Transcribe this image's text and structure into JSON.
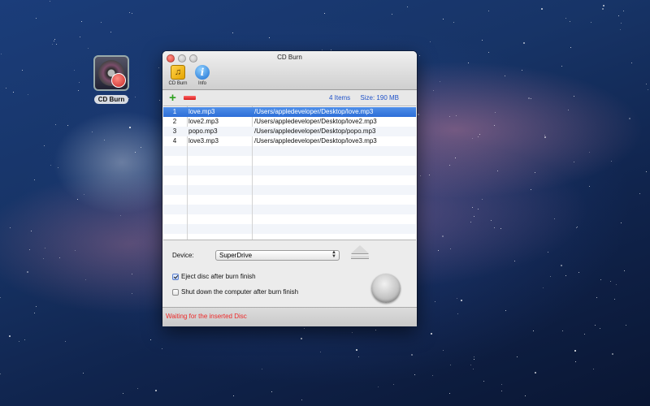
{
  "desktop": {
    "icon_label": "CD Burn"
  },
  "window": {
    "title": "CD Burn",
    "toolbar": [
      {
        "label": "CD Burn",
        "icon": "music-note-icon"
      },
      {
        "label": "Info",
        "icon": "info-icon"
      }
    ]
  },
  "list": {
    "count_text": "4 Items",
    "size_text": "Size: 190 MB",
    "rows": [
      {
        "num": "1",
        "name": "love.mp3",
        "path": "/Users/appledeveloper/Desktop/love.mp3",
        "selected": true
      },
      {
        "num": "2",
        "name": "love2.mp3",
        "path": "/Users/appledeveloper/Desktop/love2.mp3",
        "selected": false
      },
      {
        "num": "3",
        "name": "popo.mp3",
        "path": "/Users/appledeveloper/Desktop/popo.mp3",
        "selected": false
      },
      {
        "num": "4",
        "name": "love3.mp3",
        "path": "/Users/appledeveloper/Desktop/love3.mp3",
        "selected": false
      }
    ]
  },
  "options": {
    "device_label": "Device:",
    "device_value": "SuperDrive",
    "eject_label": "Eject disc after burn finish",
    "eject_checked": true,
    "shutdown_label": "Shut down the computer after burn finish",
    "shutdown_checked": false
  },
  "status": {
    "text": "Waiting for the inserted Disc",
    "color": "#ee2a2a"
  },
  "colors": {
    "selection": "#3a7be0",
    "summary_text": "#1f52c9"
  }
}
